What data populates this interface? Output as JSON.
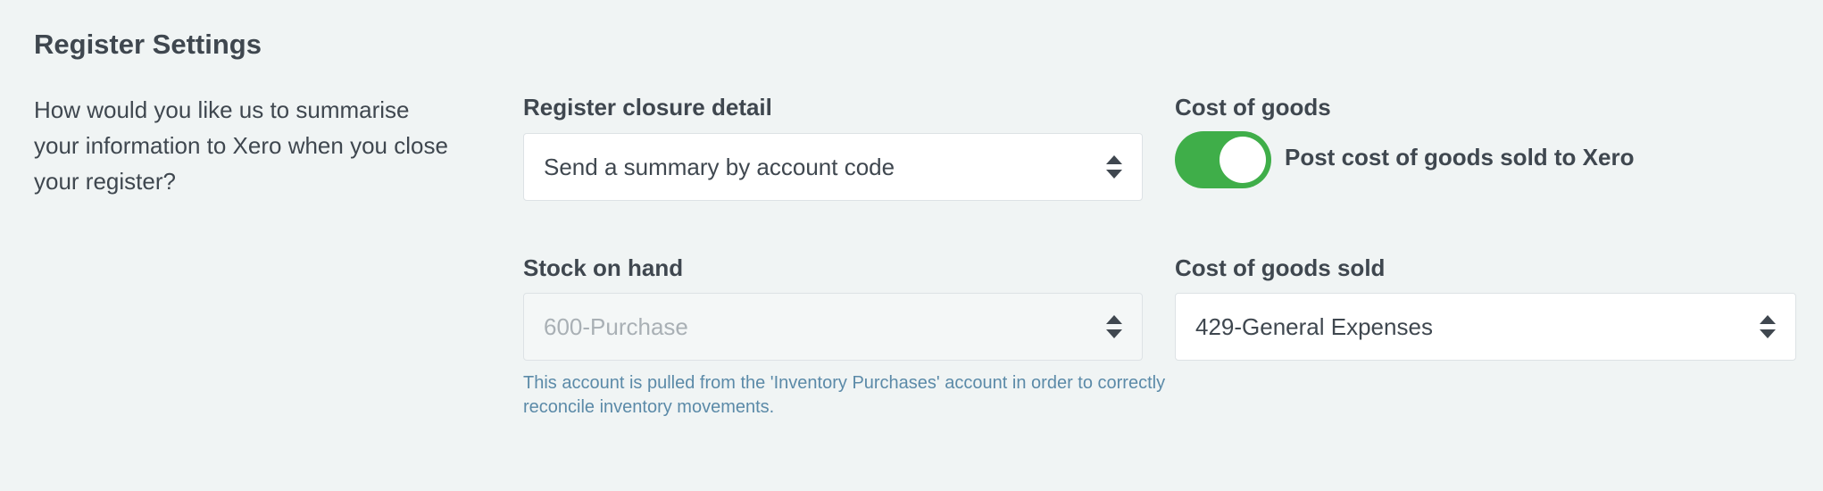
{
  "register_settings": {
    "title": "Register Settings",
    "description": "How would you like us to summarise your information to Xero when you close your register?"
  },
  "register_closure": {
    "label": "Register closure detail",
    "value": "Send a summary by account code"
  },
  "cost_of_goods": {
    "label": "Cost of goods",
    "toggle_on": true,
    "toggle_label": "Post cost of goods sold to Xero",
    "toggle_color": "#3fae49"
  },
  "stock_on_hand": {
    "label": "Stock on hand",
    "value": "600-Purchase",
    "disabled": true,
    "help": "This account is pulled from the 'Inventory Purchases' account in order to correctly reconcile inventory movements."
  },
  "cost_of_goods_sold": {
    "label": "Cost of goods sold",
    "value": "429-General Expenses"
  }
}
